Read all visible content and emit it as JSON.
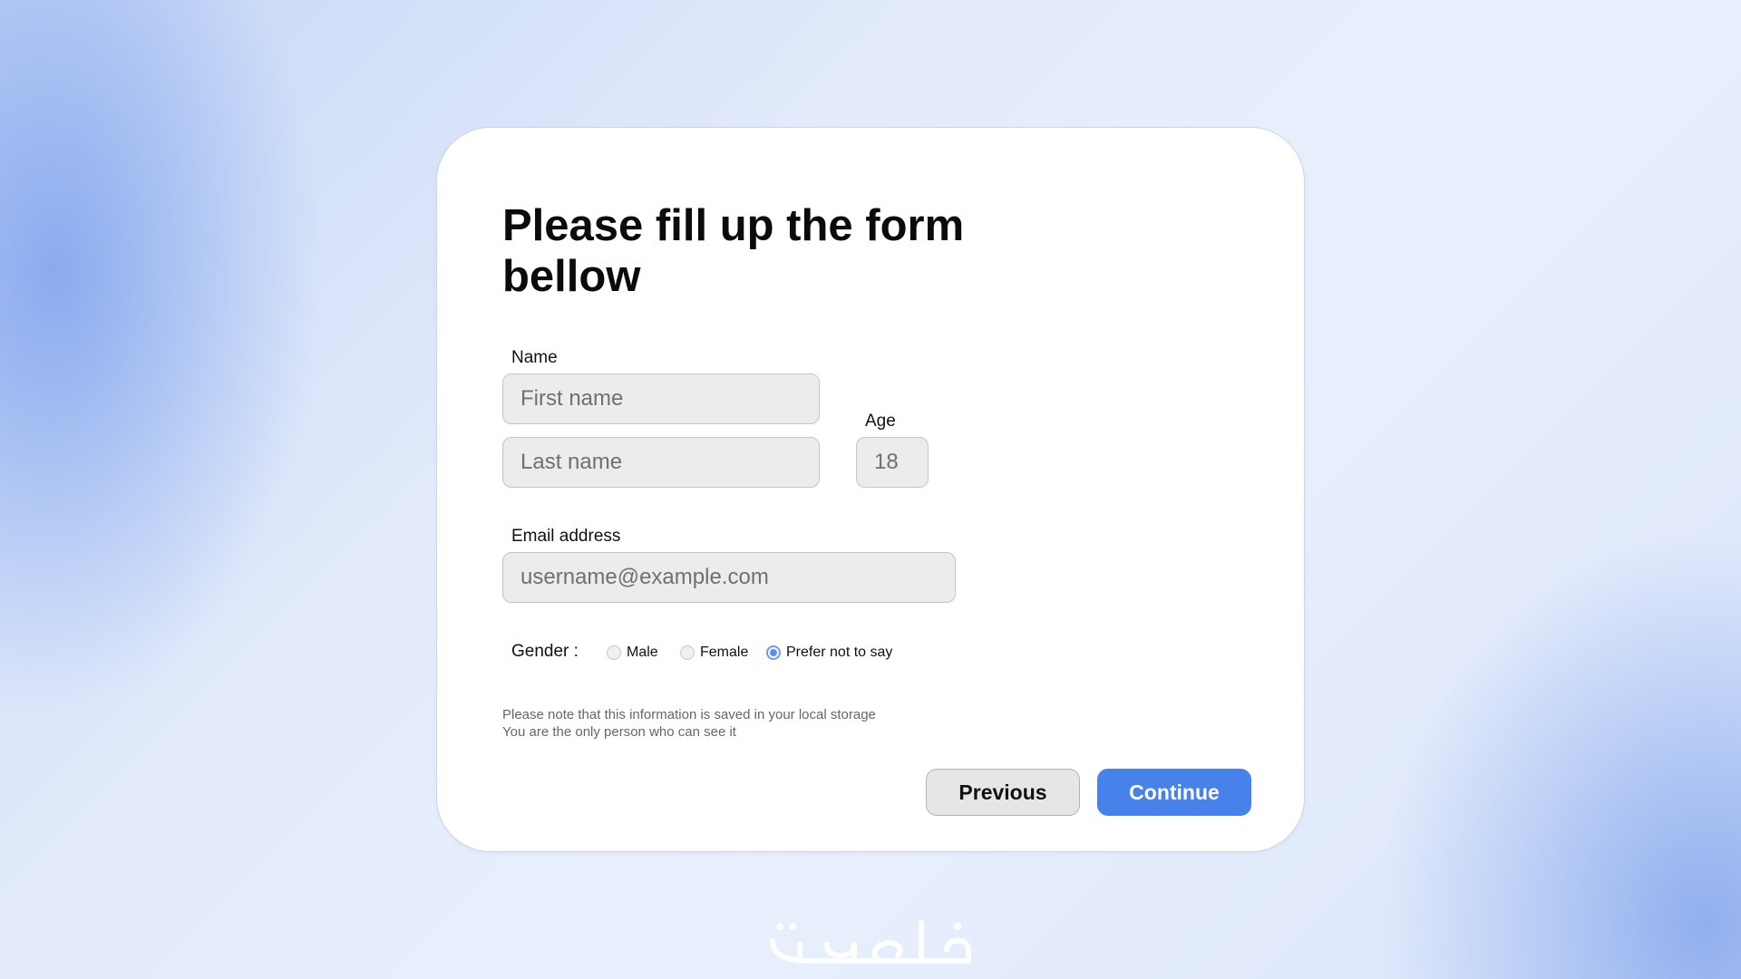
{
  "form": {
    "title": "Please fill up the form bellow",
    "name_label": "Name",
    "first_name_placeholder": "First name",
    "last_name_placeholder": "Last name",
    "age_label": "Age",
    "age_placeholder": "18",
    "email_label": "Email address",
    "email_placeholder": "username@example.com",
    "gender_label": "Gender :",
    "gender_options": [
      {
        "label": "Male",
        "selected": false
      },
      {
        "label": "Female",
        "selected": false
      },
      {
        "label": "Prefer not to say",
        "selected": true
      }
    ],
    "note_line1": "Please note that this information is saved in your local storage",
    "note_line2": "You are the only person who can see it"
  },
  "buttons": {
    "previous": "Previous",
    "continue": "Continue"
  },
  "watermark": {
    "text": "خمسات",
    "icon": "khamsat-logo-icon"
  },
  "colors": {
    "accent": "#4782ea",
    "radio_selected": "#5d8ee9",
    "field_bg": "#ececec"
  }
}
